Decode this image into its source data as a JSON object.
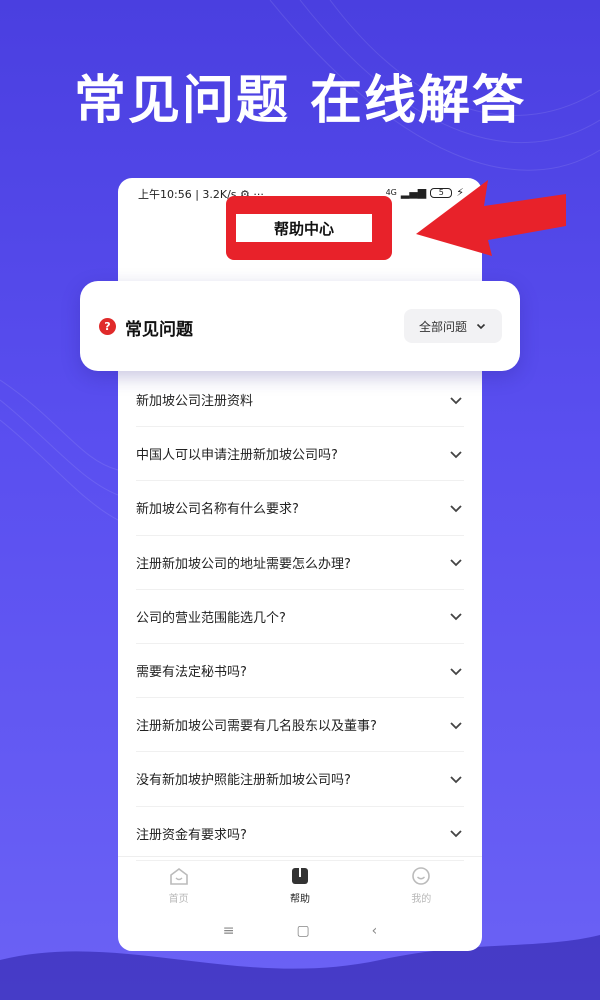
{
  "headline": "常见问题 在线解答",
  "status_bar": {
    "left": "上午10:56 | 3.2K/s ⚙ ···",
    "signal": "4G",
    "battery": "5"
  },
  "header": {
    "title": "帮助中心"
  },
  "faq_card": {
    "title": "常见问题",
    "filter_label": "全部问题"
  },
  "faq_items": [
    "新加坡公司注册资料",
    "中国人可以申请注册新加坡公司吗?",
    "新加坡公司名称有什么要求?",
    "注册新加坡公司的地址需要怎么办理?",
    "公司的营业范围能选几个?",
    "需要有法定秘书吗?",
    "注册新加坡公司需要有几名股东以及董事?",
    "没有新加坡护照能注册新加坡公司吗?",
    "注册资金有要求吗?"
  ],
  "tabbar": {
    "home": "首页",
    "help": "帮助",
    "mine": "我的"
  },
  "colors": {
    "background": "#5a4ff0",
    "highlight_red": "#e8222a"
  }
}
